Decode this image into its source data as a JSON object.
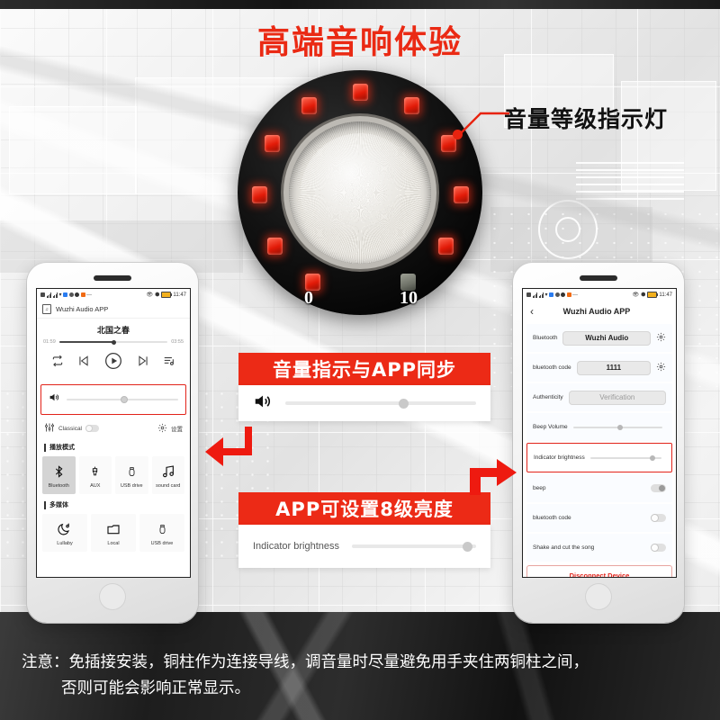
{
  "page": {
    "title": "高端音响体验"
  },
  "knob": {
    "min_label": "0",
    "max_label": "10",
    "led_count": 11,
    "lit_count": 10,
    "callout": "音量等级指示灯",
    "led_color": "#e21b08",
    "off_color": "#6f7268"
  },
  "banners": [
    {
      "label": "音量指示与APP同步"
    },
    {
      "label": "APP可设置8级亮度"
    }
  ],
  "volume_panel": {
    "icon": "speaker-icon",
    "value_percent": 62
  },
  "brightness_panel": {
    "label": "Indicator brightness",
    "value_percent": 93
  },
  "phone_left": {
    "status": {
      "time": "11:47"
    },
    "app_name": "Wuzhi Audio APP",
    "player": {
      "song": "北国之春",
      "elapsed": "01:59",
      "total": "03:55",
      "progress_percent": 50,
      "controls": [
        "repeat-icon",
        "previous-icon",
        "play-icon",
        "next-icon",
        "playlist-icon"
      ]
    },
    "volume": {
      "icon": "speaker-icon",
      "value_percent": 52
    },
    "eq": {
      "label": "Classical",
      "toggle_on": false,
      "settings_label": "设置"
    },
    "sections": [
      {
        "heading": "播放模式",
        "tiles": [
          {
            "label": "Bluetooth",
            "icon": "bluetooth-icon",
            "active": true
          },
          {
            "label": "AUX",
            "icon": "aux-plug-icon",
            "active": false
          },
          {
            "label": "USB drive",
            "icon": "usb-drive-icon",
            "active": false
          },
          {
            "label": "sound card",
            "icon": "music-note-icon",
            "active": false
          }
        ]
      },
      {
        "heading": "多媒体",
        "tiles": [
          {
            "label": "Lullaby",
            "icon": "moon-note-icon",
            "active": false
          },
          {
            "label": "Local",
            "icon": "folder-icon",
            "active": false
          },
          {
            "label": "USB drive",
            "icon": "usb-drive-icon",
            "active": false
          }
        ]
      }
    ]
  },
  "phone_right": {
    "status": {
      "time": "11:47"
    },
    "nav": {
      "back_icon": "chevron-left-icon",
      "title": "Wuzhi Audio APP"
    },
    "rows": [
      {
        "label": "Bluetooth",
        "value": "Wuzhi Audio",
        "type": "pill",
        "gear": true
      },
      {
        "label": "bluetooth code",
        "value": "1111",
        "type": "pill",
        "gear": true
      },
      {
        "label": "Authenticity",
        "value": "Verification",
        "type": "pill-dim",
        "gear": false
      },
      {
        "label": "Beep Volume",
        "type": "slider",
        "value_percent": 53
      },
      {
        "label": "Indicator brightness",
        "type": "slider",
        "value_percent": 88,
        "highlight": true
      },
      {
        "label": "beep",
        "type": "toggle",
        "on": true
      },
      {
        "label": "bluetooth code",
        "type": "toggle",
        "on": false
      },
      {
        "label": "Shake and cut the song",
        "type": "toggle",
        "on": false
      }
    ],
    "disconnect_label": "Disconnect Device"
  },
  "note": {
    "line1": "注意：免插接安装，铜柱作为连接导线，调音量时尽量避免用手夹住两铜柱之间，",
    "line2": "否则可能会影响正常显示。"
  }
}
